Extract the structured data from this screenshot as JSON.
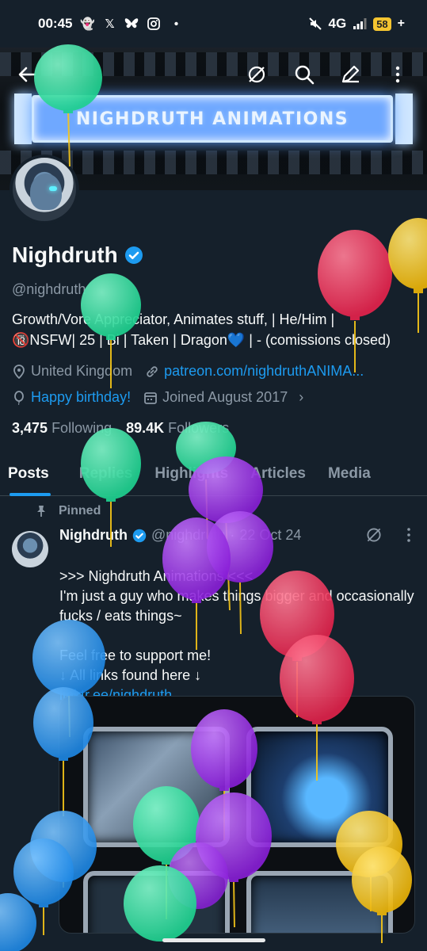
{
  "status_bar": {
    "time": "00:45",
    "network": "4G",
    "battery": "58"
  },
  "banner": {
    "title": "NIGHDRUTH ANIMATIONS"
  },
  "profile": {
    "name": "Nighdruth",
    "handle": "@nighdruth",
    "bio_line1": "Growth/Vore Appreciator, Animates stuff, | He/Him |",
    "bio_line2": "🔞NSFW| 25 | Bi | Taken | Dragon💙 | - (comissions closed)",
    "location": "United Kingdom",
    "website": "patreon.com/nighdruthANIMA...",
    "birthday": "Happy birthday!",
    "joined": "Joined August 2017",
    "following_count": "3,475",
    "following_label": "Following",
    "followers_count": "89.4K",
    "followers_label": "Followers"
  },
  "tabs": [
    {
      "label": "Posts"
    },
    {
      "label": "Replies"
    },
    {
      "label": "Highlights"
    },
    {
      "label": "Articles"
    },
    {
      "label": "Media"
    }
  ],
  "pinned_post": {
    "pinned_label": "Pinned",
    "author": "Nighdruth",
    "handle": "@nighdruth",
    "separator": "·",
    "date": "22 Oct 24",
    "text": ">>> Nighdruth Animations <<<\nI'm just a guy who makes things bigger and occasionally fucks / eats things~\n\nFeel free to support me!\n↓ All links found here ↓",
    "link": "linktr.ee/nighdruth"
  },
  "colors": {
    "background": "#15202b",
    "accent": "#1d9bf0",
    "muted": "#8b98a5",
    "balloon_green": "#2ee6a0",
    "balloon_red": "#f03a5f",
    "balloon_yellow": "#f5c518",
    "balloon_purple": "#9b30e6",
    "balloon_blue": "#2f9af0"
  }
}
